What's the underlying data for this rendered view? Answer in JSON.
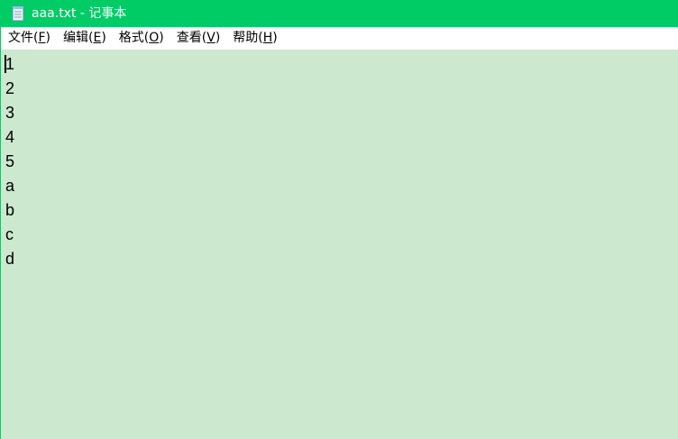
{
  "window": {
    "title": "aaa.txt - 记事本",
    "icon": "notepad-icon"
  },
  "menubar": {
    "items": [
      {
        "label": "文件(",
        "key": "F",
        "close": ")"
      },
      {
        "label": "编辑(",
        "key": "E",
        "close": ")"
      },
      {
        "label": "格式(",
        "key": "O",
        "close": ")"
      },
      {
        "label": "查看(",
        "key": "V",
        "close": ")"
      },
      {
        "label": "帮助(",
        "key": "H",
        "close": ")"
      }
    ]
  },
  "editor": {
    "lines": [
      "1",
      "2",
      "3",
      "4",
      "5",
      "a",
      "b",
      "c",
      "d"
    ],
    "background": "#cce8cf"
  },
  "colors": {
    "titlebar": "#00cc66",
    "editor_bg": "#cce8cf",
    "menubar_bg": "#ffffff"
  }
}
